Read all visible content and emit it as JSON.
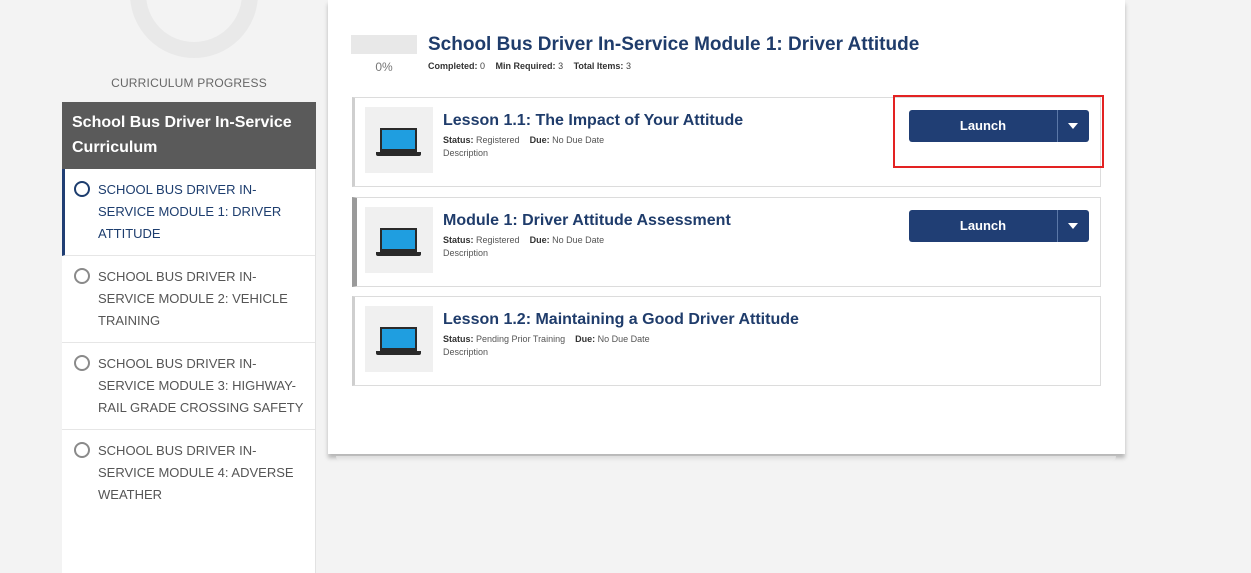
{
  "progress": {
    "percent_display": "0%",
    "label": "CURRICULUM PROGRESS"
  },
  "curriculum": {
    "title": "School Bus Driver In-Service Curriculum",
    "modules": [
      {
        "label": "SCHOOL BUS DRIVER IN-SERVICE MODULE 1: DRIVER ATTITUDE",
        "state": "active"
      },
      {
        "label": "SCHOOL BUS DRIVER IN-SERVICE MODULE 2: VEHICLE TRAINING",
        "state": "inactive"
      },
      {
        "label": "SCHOOL BUS DRIVER IN-SERVICE MODULE 3: HIGHWAY-RAIL GRADE CROSSING SAFETY",
        "state": "inactive"
      },
      {
        "label": "SCHOOL BUS DRIVER IN-SERVICE MODULE 4: ADVERSE WEATHER",
        "state": "inactive"
      }
    ]
  },
  "module": {
    "title": "School Bus Driver In-Service Module 1: Driver Attitude",
    "progress_percent": "0%",
    "progress_fraction": 0,
    "completed_label": "Completed:",
    "completed_value": "0",
    "min_required_label": "Min Required:",
    "min_required_value": "3",
    "total_items_label": "Total Items:",
    "total_items_value": "3"
  },
  "lessons": [
    {
      "title": "Lesson 1.1: The Impact of Your Attitude",
      "status_label": "Status:",
      "status": "Registered",
      "due_label": "Due:",
      "due": "No Due Date",
      "description": "Description",
      "button": "Launch",
      "icon": "laptop-icon"
    },
    {
      "title": "Module 1: Driver Attitude Assessment",
      "status_label": "Status:",
      "status": "Registered",
      "due_label": "Due:",
      "due": "No Due Date",
      "description": "Description",
      "button": "Launch",
      "icon": "laptop-icon"
    },
    {
      "title": "Lesson 1.2: Maintaining a Good Driver Attitude",
      "status_label": "Status:",
      "status": "Pending Prior Training",
      "due_label": "Due:",
      "due": "No Due Date",
      "description": "Description",
      "icon": "laptop-icon"
    }
  ],
  "colors": {
    "primary": "#203e74",
    "title": "#1f3c6b",
    "header_bg": "#5a5a5a",
    "highlight": "#e32222",
    "laptop_screen": "#1f9ee0"
  }
}
